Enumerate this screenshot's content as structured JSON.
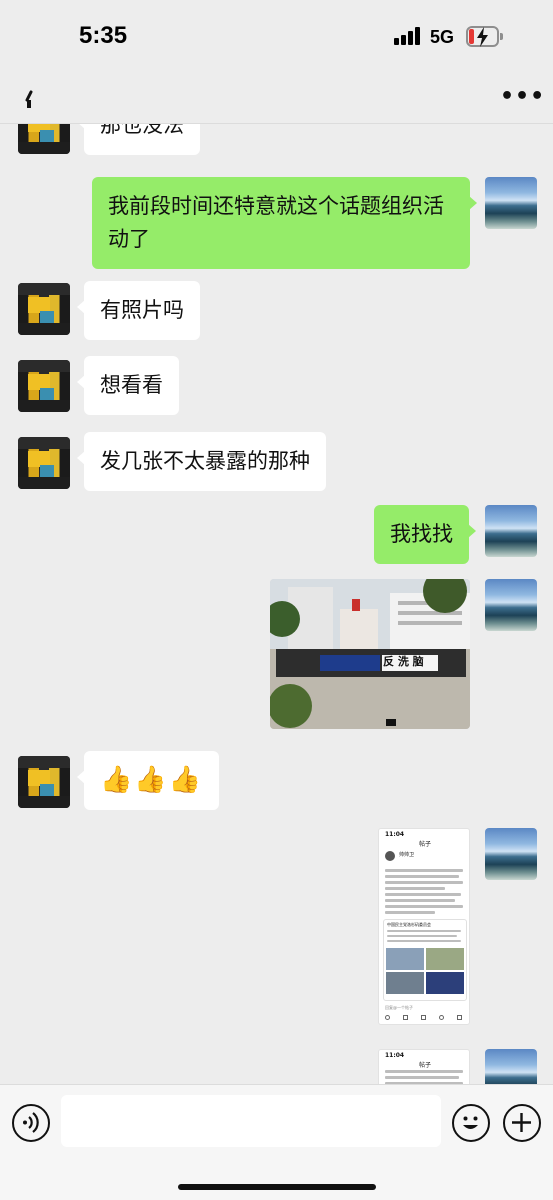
{
  "status": {
    "time": "5:35",
    "network": "5G",
    "battery_color": "#e53935"
  },
  "nav": {
    "back_icon": "back-arrow-icon",
    "more_icon": "more-icon",
    "more_label": "•••"
  },
  "messages": [
    {
      "side": "left",
      "text": "那也没法"
    },
    {
      "side": "right",
      "text_line1": "我前段时间还特意就这个话题组织活",
      "text_line2": "动了"
    },
    {
      "side": "left",
      "text": "有照片吗"
    },
    {
      "side": "left",
      "text": "想看看"
    },
    {
      "side": "left",
      "text": "发几张不太暴露的那种"
    },
    {
      "side": "right",
      "text": "我找找"
    },
    {
      "side": "right",
      "type": "photo",
      "banner_text": "反 洗 脑"
    },
    {
      "side": "left",
      "text": "👍👍👍"
    },
    {
      "side": "right",
      "type": "screenshot",
      "header_time": "11:04",
      "header_title": "帖子",
      "username": "帅帅卫",
      "quote_source": "中国民主党洛杉矶委员会",
      "footer_placeholder": "回复@一个帖子"
    },
    {
      "side": "right",
      "type": "screenshot",
      "header_time": "11:04",
      "header_title": "帖子"
    }
  ],
  "input": {
    "voice_icon": "voice-icon",
    "emoji_icon": "emoji-icon",
    "plus_icon": "plus-icon"
  },
  "colors": {
    "background": "#ededed",
    "bubble_right": "#95ec69",
    "bubble_left": "#ffffff"
  }
}
